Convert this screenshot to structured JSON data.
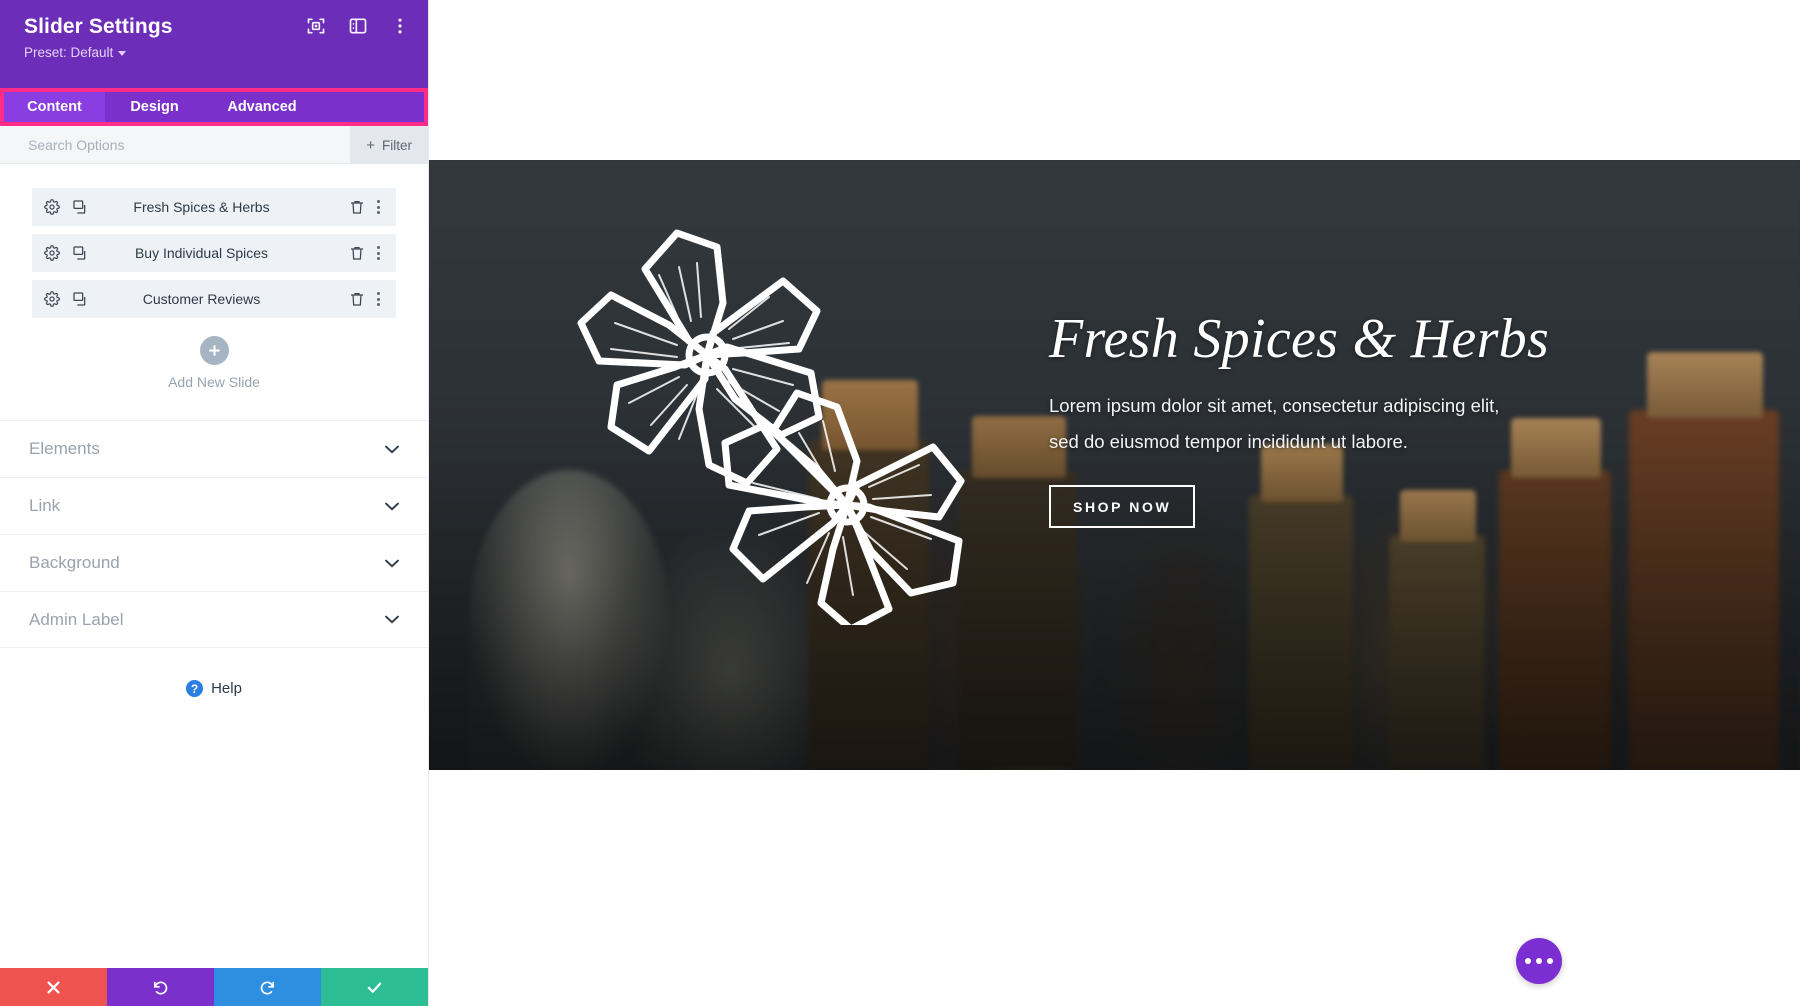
{
  "panel": {
    "title": "Slider Settings",
    "preset_label": "Preset: Default",
    "header_icons": [
      {
        "name": "focus-icon"
      },
      {
        "name": "layout-panel-icon"
      },
      {
        "name": "more-vertical-icon"
      }
    ],
    "tabs": [
      {
        "label": "Content",
        "active": true
      },
      {
        "label": "Design",
        "active": false
      },
      {
        "label": "Advanced",
        "active": false
      }
    ],
    "highlight_color": "#ff2d87",
    "header_color": "#6c2eb9",
    "search": {
      "placeholder": "Search Options",
      "value": "",
      "filter_label": "Filter",
      "filter_plus": "+"
    },
    "slides": [
      {
        "label": "Fresh Spices & Herbs"
      },
      {
        "label": "Buy Individual Spices"
      },
      {
        "label": "Customer Reviews"
      }
    ],
    "add_slide_label": "Add New Slide",
    "sections": [
      {
        "label": "Elements"
      },
      {
        "label": "Link"
      },
      {
        "label": "Background"
      },
      {
        "label": "Admin Label"
      }
    ],
    "help_label": "Help",
    "help_glyph": "?",
    "footer": [
      {
        "name": "cancel-button",
        "color": "#ef5350"
      },
      {
        "name": "undo-button",
        "color": "#7b30cc"
      },
      {
        "name": "redo-button",
        "color": "#2e8fe0"
      },
      {
        "name": "save-button",
        "color": "#2cbd94"
      }
    ]
  },
  "preview": {
    "slide": {
      "heading": "Fresh Spices & Herbs",
      "body_line_1": "Lorem ipsum dolor sit amet, consectetur adipiscing elit,",
      "body_line_2": "sed do eiusmod tempor incididunt ut labore.",
      "button_label": "SHOP NOW"
    },
    "pagination": {
      "total": 3,
      "active_index": 0
    },
    "fab": {
      "name": "page-settings-fab"
    }
  }
}
